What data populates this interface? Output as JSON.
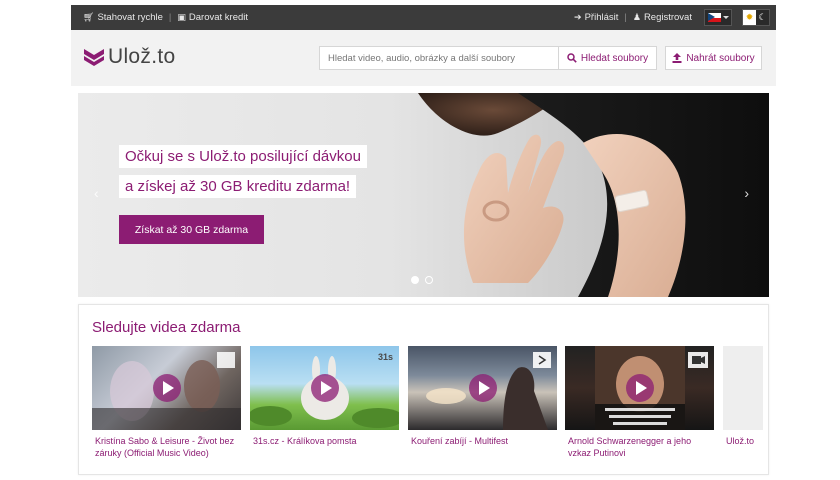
{
  "topbar": {
    "download_fast": "Stahovat rychle",
    "donate_credit": "Darovat kredit",
    "separator": "|",
    "login": "Přihlásit",
    "register": "Registrovat",
    "language_icon": "czech-flag-icon"
  },
  "header": {
    "logo_text": "Ulož.to",
    "search_placeholder": "Hledat video, audio, obrázky a další soubory",
    "search_button": "Hledat soubory",
    "upload_button": "Nahrát soubory"
  },
  "hero": {
    "line1": "Očkuj se s Ulož.to posilující dávkou",
    "line2": "a získej až 30 GB kreditu zdarma!",
    "cta": "Získat až 30 GB zdarma",
    "slides": 2,
    "active_slide": 1
  },
  "videos": {
    "heading": "Sledujte videa zdarma",
    "items": [
      {
        "title": "Kristína Sabo & Leisure - Život bez záruky (Official Music Video)"
      },
      {
        "title": "31s.cz - Králíkova pomsta",
        "badge": "31s"
      },
      {
        "title": "Kouření zabíjí - Multifest"
      },
      {
        "title": "Arnold Schwarzenegger a jeho vzkaz Putinovi"
      },
      {
        "title": "Ulož.to"
      }
    ]
  },
  "colors": {
    "brand": "#8c1c73",
    "topbar": "#3b3b3b",
    "header_bg": "#f2f2f2"
  }
}
